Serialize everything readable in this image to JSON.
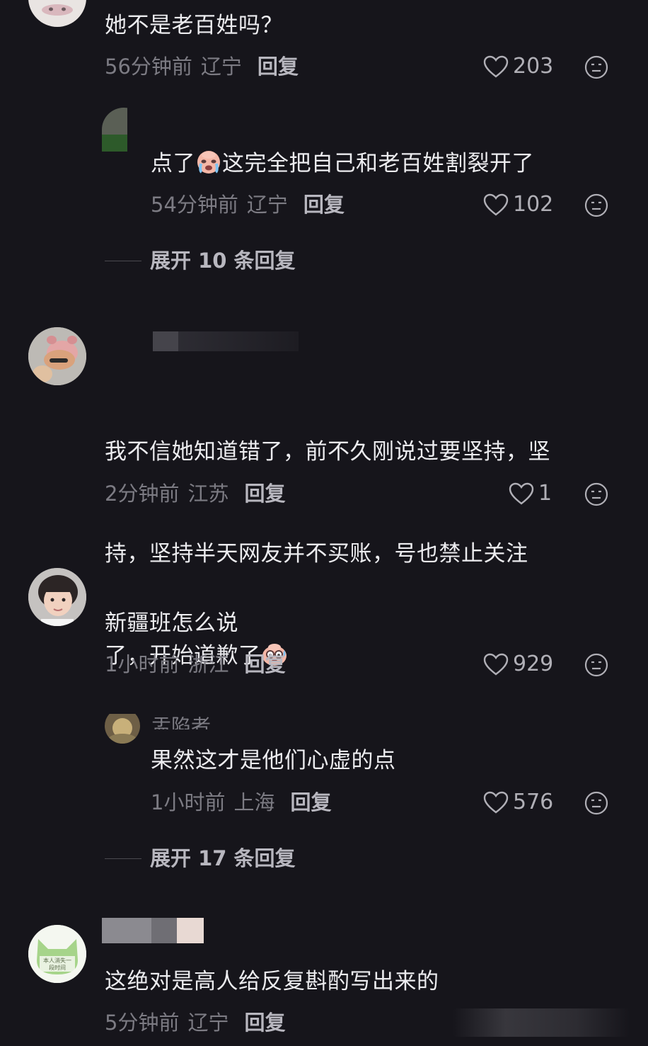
{
  "comments": [
    {
      "text": "她不是老百姓吗？",
      "time": "56分钟前",
      "location": "辽宁",
      "reply_label": "回复",
      "likes": "203"
    },
    {
      "text_before": "点了",
      "text_after": "这完全把自己和老百姓割裂开了",
      "time": "54分钟前",
      "location": "辽宁",
      "reply_label": "回复",
      "likes": "102"
    },
    {
      "text_lines": [
        "我不信她知道错了，前不久刚说过要坚持，坚",
        "持，坚持半天网友并不买账，号也禁止关注",
        "了，开始道歉了"
      ],
      "time": "2分钟前",
      "location": "江苏",
      "reply_label": "回复",
      "likes": "1"
    },
    {
      "text": "新疆班怎么说",
      "time": "1小时前",
      "location": "浙江",
      "reply_label": "回复",
      "likes": "929"
    },
    {
      "username_partial": "盂陷者",
      "text": "果然这才是他们心虚的点",
      "time": "1小时前",
      "location": "上海",
      "reply_label": "回复",
      "likes": "576"
    },
    {
      "text": "这绝对是高人给反复斟酌写出来的",
      "time": "5分钟前",
      "location": "辽宁",
      "reply_label": "回复"
    }
  ],
  "expand_1": "展开 10 条回复",
  "expand_2": "展开 17 条回复",
  "avatar_badge_text": [
    "本人消失一",
    "段时间"
  ],
  "colors": {
    "background": "#16151b",
    "text": "#ececef",
    "meta": "#7c7b83",
    "reply": "#b8b7bf",
    "avatar_green": "#a6d48a"
  }
}
